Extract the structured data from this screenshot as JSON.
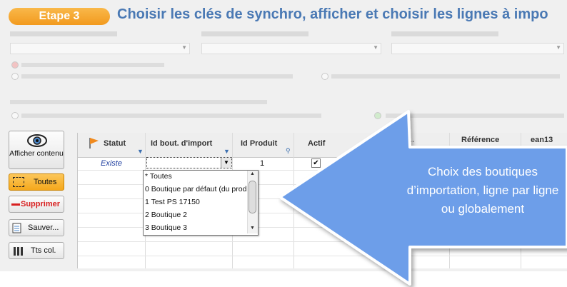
{
  "header": {
    "step_label": "Etape 3",
    "title": "Choisir les clés de synchro, afficher et choisir les lignes à impo"
  },
  "left_panel": {
    "show_content_label": "Afficher contenu",
    "all_label": "Toutes",
    "delete_label": "Supprimer",
    "save_label": "Sauver...",
    "all_cols_label": "Tts col."
  },
  "grid": {
    "columns": [
      "Statut",
      "Id  bout. d'import",
      "Id Produit",
      "Actif",
      "Référence",
      "ean13",
      "..."
    ],
    "row1": {
      "statut": "Existe",
      "id_produit": "1"
    }
  },
  "dropdown": {
    "items": [
      "* Toutes",
      "0 Boutique par défaut (du prod",
      "1 Test PS 17150",
      "2 Boutique 2",
      "3 Boutique 3"
    ],
    "scroll_up": "▲",
    "scroll_down": "▼"
  },
  "callout": {
    "text": "Choix des boutiques d’importation, ligne par ligne ou globalement"
  },
  "colors": {
    "accent_orange": "#f29a1e",
    "title_blue": "#4a79b4",
    "callout_blue": "#6d9ee9"
  }
}
